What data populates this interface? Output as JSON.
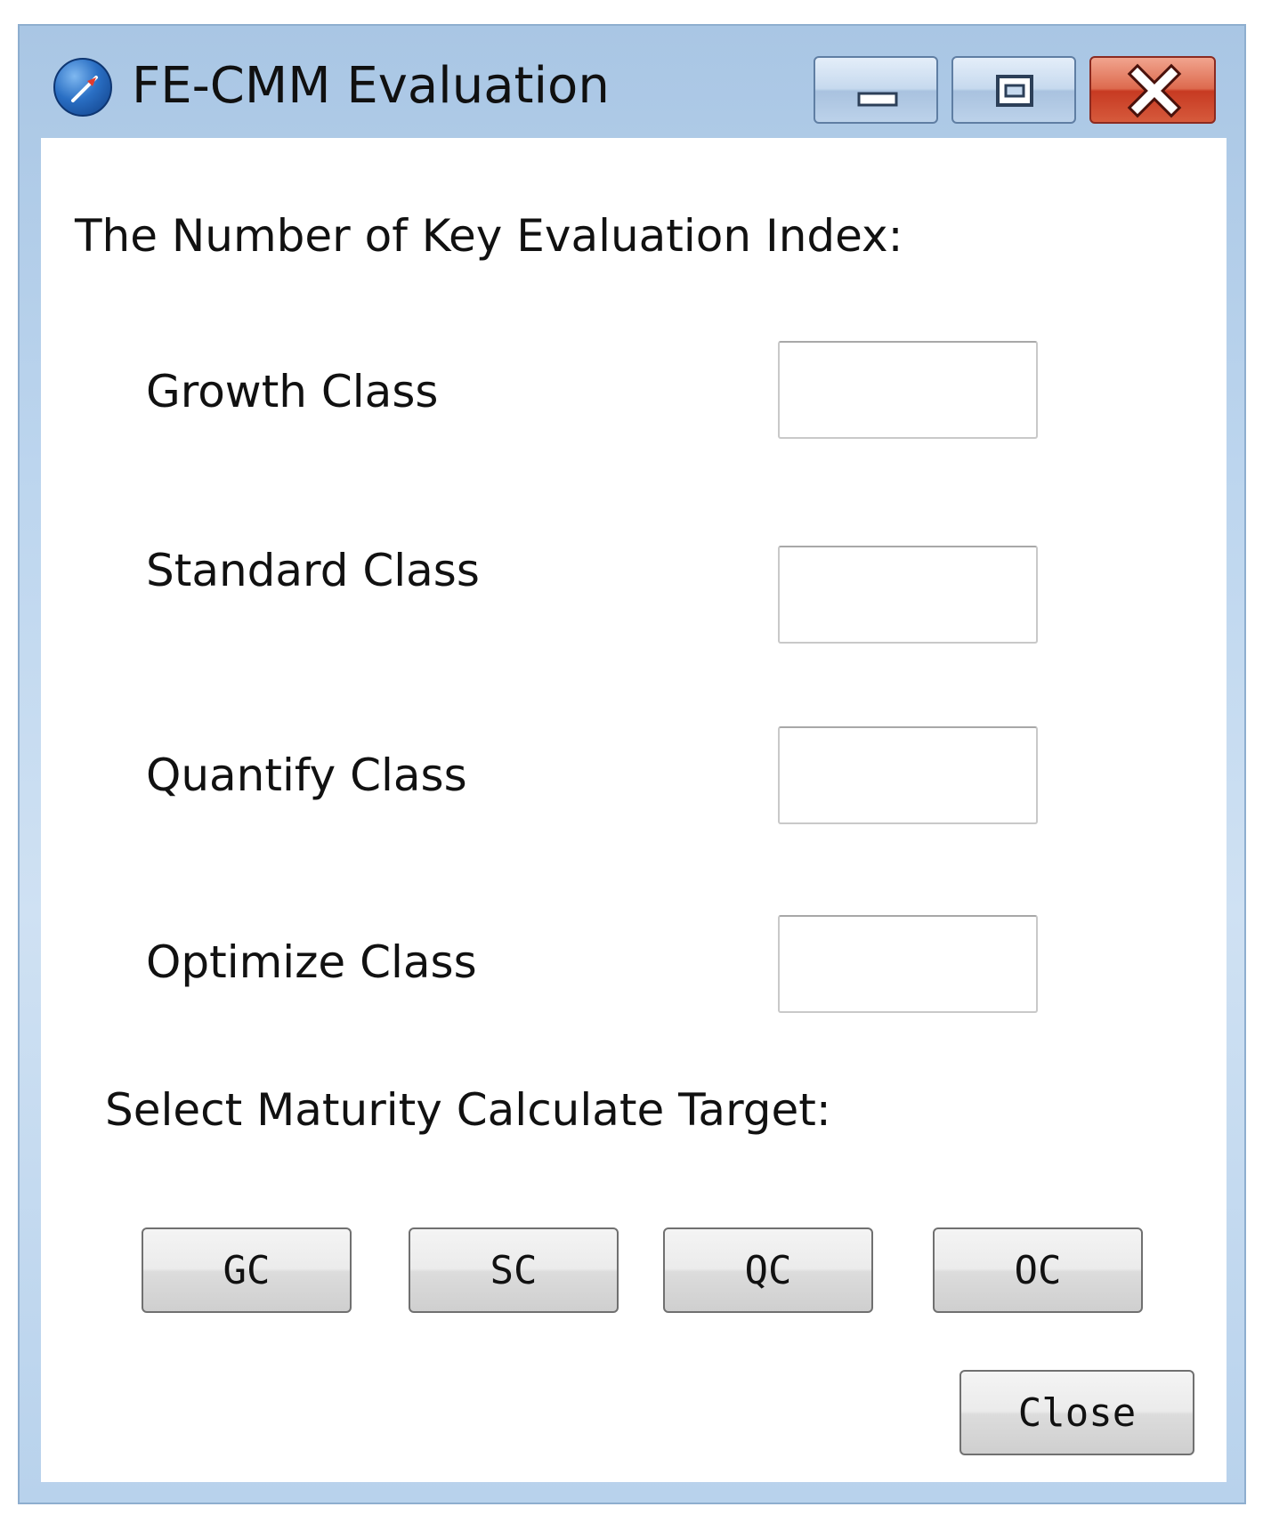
{
  "window": {
    "title": "FE-CMM Evaluation",
    "icon": "compass-icon",
    "controls": [
      "minimize-icon",
      "restore-icon",
      "close-icon"
    ]
  },
  "form": {
    "heading": "The Number of Key Evaluation Index:",
    "fields": [
      {
        "label": "Growth Class",
        "value": ""
      },
      {
        "label": "Standard Class",
        "value": ""
      },
      {
        "label": "Quantify Class",
        "value": ""
      },
      {
        "label": "Optimize Class",
        "value": ""
      }
    ],
    "target_heading": "Select  Maturity Calculate Target:",
    "target_buttons": [
      "GC",
      "SC",
      "QC",
      "OC"
    ],
    "close_label": "Close"
  },
  "colors": {
    "frame": "#bcd5ee",
    "close_button": "#c73a22",
    "button_face": "#e6e6e6"
  }
}
